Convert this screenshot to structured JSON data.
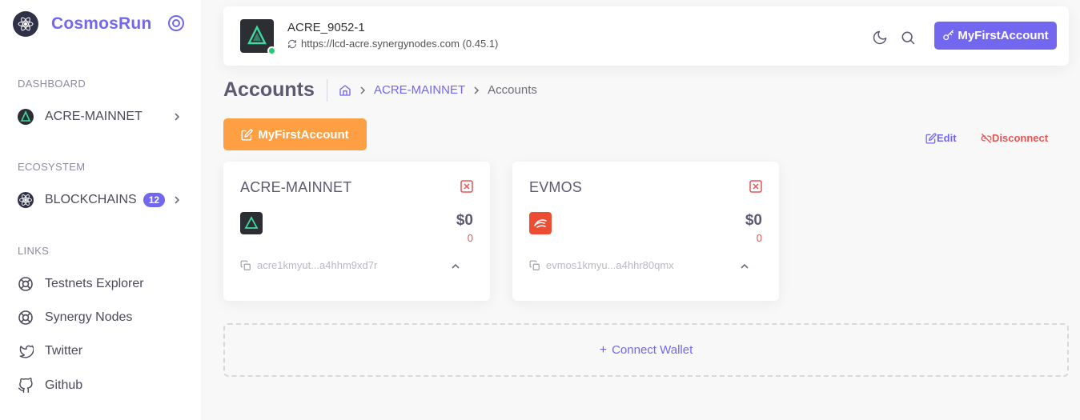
{
  "sidebar": {
    "brand": "CosmosRun",
    "sections": {
      "dashboard": "DASHBOARD",
      "ecosystem": "ECOSYSTEM",
      "links": "LINKS"
    },
    "items": {
      "chain": "ACRE-MAINNET",
      "blockchains": "BLOCKCHAINS",
      "blockchains_count": "12",
      "testnets": "Testnets Explorer",
      "synergy": "Synergy Nodes",
      "twitter": "Twitter",
      "github": "Github"
    }
  },
  "header": {
    "chain_id": "ACRE_9052-1",
    "endpoint": "https://lcd-acre.synergynodes.com (0.45.1)",
    "account_button": "MyFirstAccount"
  },
  "page": {
    "title": "Accounts",
    "breadcrumb_chain": "ACRE-MAINNET",
    "breadcrumb_current": "Accounts"
  },
  "actions": {
    "account_name": "MyFirstAccount",
    "edit": "Edit",
    "disconnect": "Disconnect"
  },
  "cards": [
    {
      "title": "ACRE-MAINNET",
      "value": "$0",
      "amount": "0",
      "address": "acre1kmyut...a4hhm9xd7r"
    },
    {
      "title": "EVMOS",
      "value": "$0",
      "amount": "0",
      "address": "evmos1kmyu...a4hhr80qmx"
    }
  ],
  "connect_wallet": "Connect Wallet",
  "colors": {
    "primary": "#7367f0",
    "warning": "#ff9f43",
    "danger": "#ea5455",
    "success": "#28c76f",
    "evmos": "#ed4e33"
  }
}
